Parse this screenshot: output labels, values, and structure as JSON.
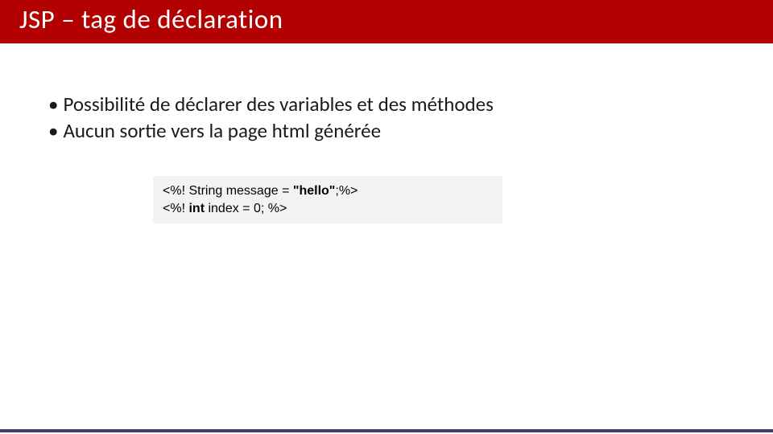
{
  "header": {
    "title": "JSP – tag de déclaration"
  },
  "bullets": {
    "b1": "Possibilité de déclarer des variables et des méthodes",
    "b2": "Aucun sortie vers la page html générée"
  },
  "code": {
    "line1_prefix": "<%! String message = ",
    "line1_string": "\"hello\"",
    "line1_suffix": ";%>",
    "line2_prefix": "<%! ",
    "line2_kw": "int",
    "line2_rest": " index = 0; %>"
  }
}
